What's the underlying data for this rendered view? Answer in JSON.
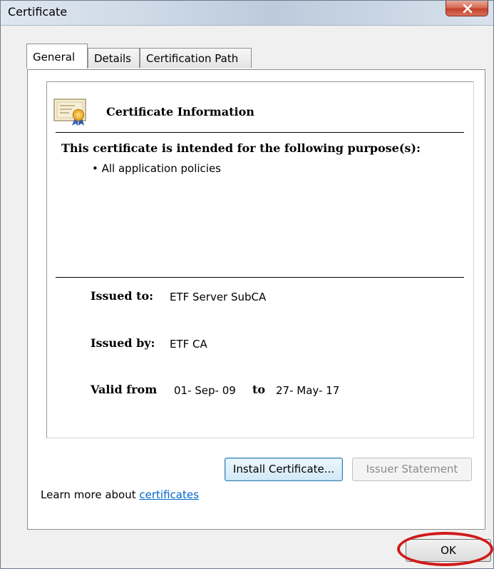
{
  "window": {
    "title": "Certificate",
    "close_icon": "close-icon"
  },
  "tabs": [
    {
      "label": "General",
      "active": true
    },
    {
      "label": "Details",
      "active": false
    },
    {
      "label": "Certification Path",
      "active": false
    }
  ],
  "info": {
    "icon": "certificate-icon",
    "title": "Certificate Information",
    "purpose_heading": "This certificate is intended for the following purpose(s):",
    "purposes": [
      "• All application policies"
    ]
  },
  "fields": {
    "issued_to_label": "Issued to:",
    "issued_to_value": "ETF Server SubCA",
    "issued_by_label": "Issued by:",
    "issued_by_value": "ETF CA",
    "valid_from_label": "Valid from",
    "valid_from_value": "01- Sep- 09",
    "valid_to_label": "to",
    "valid_to_value": "27- May- 17"
  },
  "buttons": {
    "install": "Install Certificate...",
    "issuer_statement": "Issuer Statement",
    "ok": "OK"
  },
  "learn_more": {
    "prefix": "Learn more about ",
    "link": "certificates"
  },
  "colors": {
    "highlight_circle": "#d11a1a",
    "link": "#0066cc"
  }
}
